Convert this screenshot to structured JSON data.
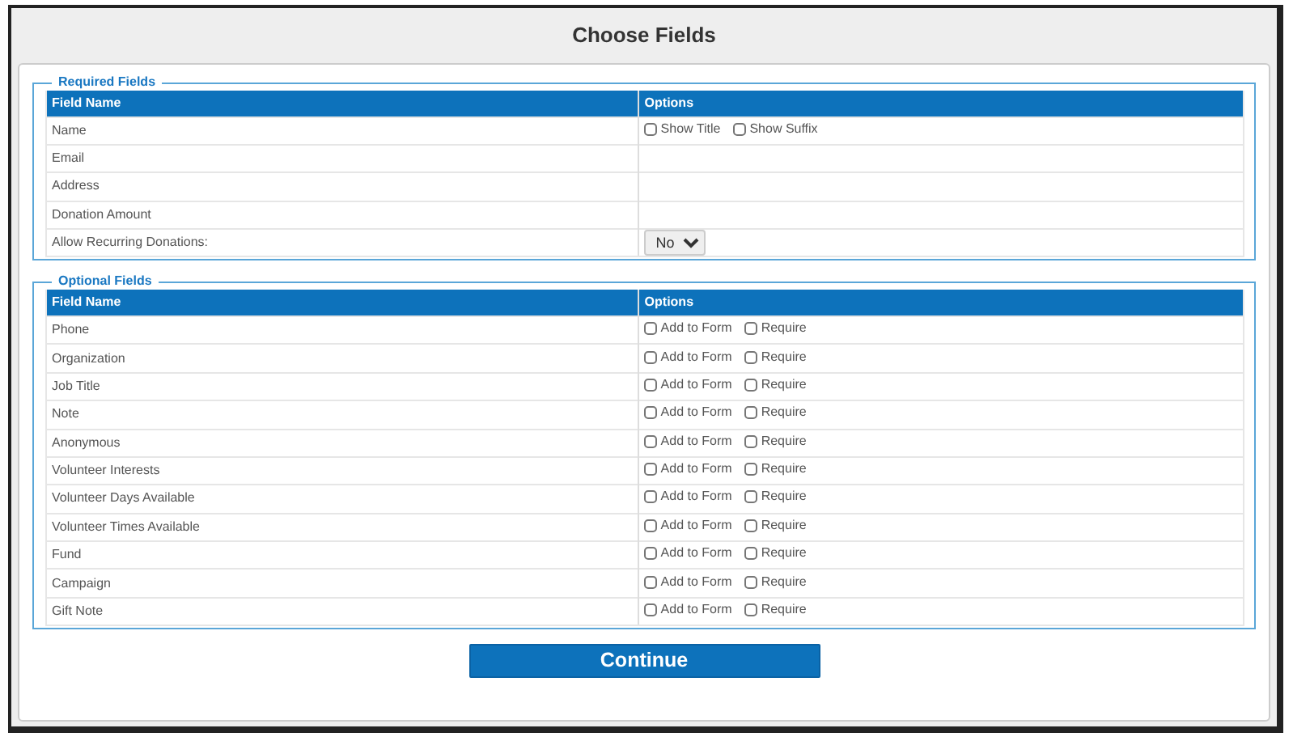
{
  "title": "Choose Fields",
  "sections": [
    {
      "legend": "Required Fields",
      "columns": [
        "Field Name",
        "Options"
      ],
      "rows": [
        {
          "field": "Name",
          "options": [
            {
              "kind": "checkbox",
              "label": "Show Title",
              "checked": false
            },
            {
              "kind": "checkbox",
              "label": "Show Suffix",
              "checked": false
            }
          ]
        },
        {
          "field": "Email",
          "options": []
        },
        {
          "field": "Address",
          "options": []
        },
        {
          "field": "Donation Amount",
          "options": []
        },
        {
          "field": "Allow Recurring Donations:",
          "options": [
            {
              "kind": "select",
              "value": "No"
            }
          ]
        }
      ]
    },
    {
      "legend": "Optional Fields",
      "columns": [
        "Field Name",
        "Options"
      ],
      "rows": [
        {
          "field": "Phone",
          "options": [
            {
              "kind": "checkbox",
              "label": "Add to Form",
              "checked": false
            },
            {
              "kind": "checkbox",
              "label": "Require",
              "checked": false
            }
          ]
        },
        {
          "field": "Organization",
          "options": [
            {
              "kind": "checkbox",
              "label": "Add to Form",
              "checked": false
            },
            {
              "kind": "checkbox",
              "label": "Require",
              "checked": false
            }
          ]
        },
        {
          "field": "Job Title",
          "options": [
            {
              "kind": "checkbox",
              "label": "Add to Form",
              "checked": false
            },
            {
              "kind": "checkbox",
              "label": "Require",
              "checked": false
            }
          ]
        },
        {
          "field": "Note",
          "options": [
            {
              "kind": "checkbox",
              "label": "Add to Form",
              "checked": false
            },
            {
              "kind": "checkbox",
              "label": "Require",
              "checked": false
            }
          ]
        },
        {
          "field": "Anonymous",
          "options": [
            {
              "kind": "checkbox",
              "label": "Add to Form",
              "checked": false
            },
            {
              "kind": "checkbox",
              "label": "Require",
              "checked": false
            }
          ]
        },
        {
          "field": "Volunteer Interests",
          "options": [
            {
              "kind": "checkbox",
              "label": "Add to Form",
              "checked": false
            },
            {
              "kind": "checkbox",
              "label": "Require",
              "checked": false
            }
          ]
        },
        {
          "field": "Volunteer Days Available",
          "options": [
            {
              "kind": "checkbox",
              "label": "Add to Form",
              "checked": false
            },
            {
              "kind": "checkbox",
              "label": "Require",
              "checked": false
            }
          ]
        },
        {
          "field": "Volunteer Times Available",
          "options": [
            {
              "kind": "checkbox",
              "label": "Add to Form",
              "checked": false
            },
            {
              "kind": "checkbox",
              "label": "Require",
              "checked": false
            }
          ]
        },
        {
          "field": "Fund",
          "options": [
            {
              "kind": "checkbox",
              "label": "Add to Form",
              "checked": false
            },
            {
              "kind": "checkbox",
              "label": "Require",
              "checked": false
            }
          ]
        },
        {
          "field": "Campaign",
          "options": [
            {
              "kind": "checkbox",
              "label": "Add to Form",
              "checked": false
            },
            {
              "kind": "checkbox",
              "label": "Require",
              "checked": false
            }
          ]
        },
        {
          "field": "Gift Note",
          "options": [
            {
              "kind": "checkbox",
              "label": "Add to Form",
              "checked": false
            },
            {
              "kind": "checkbox",
              "label": "Require",
              "checked": false
            }
          ]
        }
      ]
    }
  ],
  "button": "Continue"
}
